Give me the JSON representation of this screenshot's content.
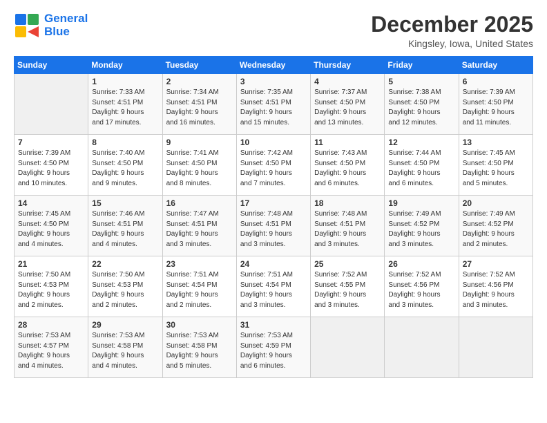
{
  "header": {
    "logo_line1": "General",
    "logo_line2": "Blue",
    "month": "December 2025",
    "location": "Kingsley, Iowa, United States"
  },
  "weekdays": [
    "Sunday",
    "Monday",
    "Tuesday",
    "Wednesday",
    "Thursday",
    "Friday",
    "Saturday"
  ],
  "weeks": [
    [
      {
        "date": "",
        "info": ""
      },
      {
        "date": "1",
        "info": "Sunrise: 7:33 AM\nSunset: 4:51 PM\nDaylight: 9 hours\nand 17 minutes."
      },
      {
        "date": "2",
        "info": "Sunrise: 7:34 AM\nSunset: 4:51 PM\nDaylight: 9 hours\nand 16 minutes."
      },
      {
        "date": "3",
        "info": "Sunrise: 7:35 AM\nSunset: 4:51 PM\nDaylight: 9 hours\nand 15 minutes."
      },
      {
        "date": "4",
        "info": "Sunrise: 7:37 AM\nSunset: 4:50 PM\nDaylight: 9 hours\nand 13 minutes."
      },
      {
        "date": "5",
        "info": "Sunrise: 7:38 AM\nSunset: 4:50 PM\nDaylight: 9 hours\nand 12 minutes."
      },
      {
        "date": "6",
        "info": "Sunrise: 7:39 AM\nSunset: 4:50 PM\nDaylight: 9 hours\nand 11 minutes."
      }
    ],
    [
      {
        "date": "7",
        "info": "Sunrise: 7:39 AM\nSunset: 4:50 PM\nDaylight: 9 hours\nand 10 minutes."
      },
      {
        "date": "8",
        "info": "Sunrise: 7:40 AM\nSunset: 4:50 PM\nDaylight: 9 hours\nand 9 minutes."
      },
      {
        "date": "9",
        "info": "Sunrise: 7:41 AM\nSunset: 4:50 PM\nDaylight: 9 hours\nand 8 minutes."
      },
      {
        "date": "10",
        "info": "Sunrise: 7:42 AM\nSunset: 4:50 PM\nDaylight: 9 hours\nand 7 minutes."
      },
      {
        "date": "11",
        "info": "Sunrise: 7:43 AM\nSunset: 4:50 PM\nDaylight: 9 hours\nand 6 minutes."
      },
      {
        "date": "12",
        "info": "Sunrise: 7:44 AM\nSunset: 4:50 PM\nDaylight: 9 hours\nand 6 minutes."
      },
      {
        "date": "13",
        "info": "Sunrise: 7:45 AM\nSunset: 4:50 PM\nDaylight: 9 hours\nand 5 minutes."
      }
    ],
    [
      {
        "date": "14",
        "info": "Sunrise: 7:45 AM\nSunset: 4:50 PM\nDaylight: 9 hours\nand 4 minutes."
      },
      {
        "date": "15",
        "info": "Sunrise: 7:46 AM\nSunset: 4:51 PM\nDaylight: 9 hours\nand 4 minutes."
      },
      {
        "date": "16",
        "info": "Sunrise: 7:47 AM\nSunset: 4:51 PM\nDaylight: 9 hours\nand 3 minutes."
      },
      {
        "date": "17",
        "info": "Sunrise: 7:48 AM\nSunset: 4:51 PM\nDaylight: 9 hours\nand 3 minutes."
      },
      {
        "date": "18",
        "info": "Sunrise: 7:48 AM\nSunset: 4:51 PM\nDaylight: 9 hours\nand 3 minutes."
      },
      {
        "date": "19",
        "info": "Sunrise: 7:49 AM\nSunset: 4:52 PM\nDaylight: 9 hours\nand 3 minutes."
      },
      {
        "date": "20",
        "info": "Sunrise: 7:49 AM\nSunset: 4:52 PM\nDaylight: 9 hours\nand 2 minutes."
      }
    ],
    [
      {
        "date": "21",
        "info": "Sunrise: 7:50 AM\nSunset: 4:53 PM\nDaylight: 9 hours\nand 2 minutes."
      },
      {
        "date": "22",
        "info": "Sunrise: 7:50 AM\nSunset: 4:53 PM\nDaylight: 9 hours\nand 2 minutes."
      },
      {
        "date": "23",
        "info": "Sunrise: 7:51 AM\nSunset: 4:54 PM\nDaylight: 9 hours\nand 2 minutes."
      },
      {
        "date": "24",
        "info": "Sunrise: 7:51 AM\nSunset: 4:54 PM\nDaylight: 9 hours\nand 3 minutes."
      },
      {
        "date": "25",
        "info": "Sunrise: 7:52 AM\nSunset: 4:55 PM\nDaylight: 9 hours\nand 3 minutes."
      },
      {
        "date": "26",
        "info": "Sunrise: 7:52 AM\nSunset: 4:56 PM\nDaylight: 9 hours\nand 3 minutes."
      },
      {
        "date": "27",
        "info": "Sunrise: 7:52 AM\nSunset: 4:56 PM\nDaylight: 9 hours\nand 3 minutes."
      }
    ],
    [
      {
        "date": "28",
        "info": "Sunrise: 7:53 AM\nSunset: 4:57 PM\nDaylight: 9 hours\nand 4 minutes."
      },
      {
        "date": "29",
        "info": "Sunrise: 7:53 AM\nSunset: 4:58 PM\nDaylight: 9 hours\nand 4 minutes."
      },
      {
        "date": "30",
        "info": "Sunrise: 7:53 AM\nSunset: 4:58 PM\nDaylight: 9 hours\nand 5 minutes."
      },
      {
        "date": "31",
        "info": "Sunrise: 7:53 AM\nSunset: 4:59 PM\nDaylight: 9 hours\nand 6 minutes."
      },
      {
        "date": "",
        "info": ""
      },
      {
        "date": "",
        "info": ""
      },
      {
        "date": "",
        "info": ""
      }
    ]
  ]
}
